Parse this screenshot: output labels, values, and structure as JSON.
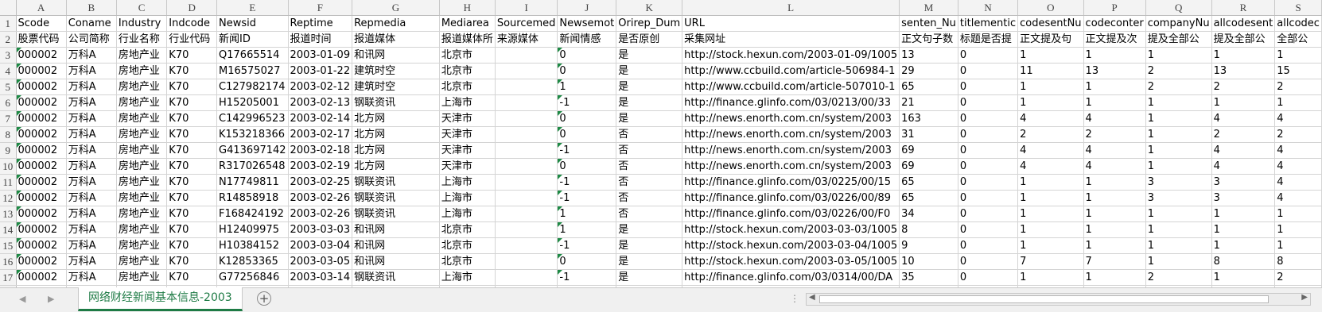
{
  "columns": [
    "A",
    "B",
    "C",
    "D",
    "E",
    "F",
    "G",
    "H",
    "I",
    "J",
    "K",
    "L",
    "M",
    "N",
    "O",
    "P",
    "Q",
    "R",
    "S"
  ],
  "rows": [
    {
      "n": "1",
      "cells": [
        "Scode",
        "Coname",
        "Industry",
        "Indcode",
        "Newsid",
        "Reptime",
        "Repmedia",
        "Mediarea",
        "Sourcemed",
        "Newsemot",
        "Orirep_Dum",
        "URL",
        "senten_Nu",
        "titlementic",
        "codesentNu",
        "codeconter",
        "companyNu",
        "allcodesent",
        "allcodec"
      ]
    },
    {
      "n": "2",
      "cells": [
        "股票代码",
        "公司简称",
        "行业名称",
        "行业代码",
        "新闻ID",
        "报道时间",
        "报道媒体",
        "报道媒体所",
        "来源媒体",
        "新闻情感",
        "是否原创",
        "采集网址",
        "正文句子数",
        "标题是否提",
        "正文提及句",
        "正文提及次",
        "提及全部公",
        "提及全部公",
        "全部公"
      ]
    },
    {
      "n": "3",
      "cells": [
        "000002",
        "万科A",
        "房地产业",
        "K70",
        "Q17665514",
        "2003-01-09",
        "和讯网",
        "北京市",
        "",
        "0",
        "是",
        "http://stock.hexun.com/2003-01-09/1005",
        "13",
        "0",
        "1",
        "1",
        "1",
        "1",
        "1"
      ]
    },
    {
      "n": "4",
      "cells": [
        "000002",
        "万科A",
        "房地产业",
        "K70",
        "M16575027",
        "2003-01-22",
        "建筑时空",
        "北京市",
        "",
        "0",
        "是",
        "http://www.ccbuild.com/article-506984-1",
        "29",
        "0",
        "11",
        "13",
        "2",
        "13",
        "15"
      ]
    },
    {
      "n": "5",
      "cells": [
        "000002",
        "万科A",
        "房地产业",
        "K70",
        "C127982174",
        "2003-02-12",
        "建筑时空",
        "北京市",
        "",
        "1",
        "是",
        "http://www.ccbuild.com/article-507010-1",
        "65",
        "0",
        "1",
        "1",
        "2",
        "2",
        "2"
      ]
    },
    {
      "n": "6",
      "cells": [
        "000002",
        "万科A",
        "房地产业",
        "K70",
        "H15205001",
        "2003-02-13",
        "钢联资讯",
        "上海市",
        "",
        "-1",
        "是",
        "http://finance.glinfo.com/03/0213/00/33",
        "21",
        "0",
        "1",
        "1",
        "1",
        "1",
        "1"
      ]
    },
    {
      "n": "7",
      "cells": [
        "000002",
        "万科A",
        "房地产业",
        "K70",
        "C142996523",
        "2003-02-14",
        "北方网",
        "天津市",
        "",
        "0",
        "是",
        "http://news.enorth.com.cn/system/2003",
        "163",
        "0",
        "4",
        "4",
        "1",
        "4",
        "4"
      ]
    },
    {
      "n": "8",
      "cells": [
        "000002",
        "万科A",
        "房地产业",
        "K70",
        "K153218366",
        "2003-02-17",
        "北方网",
        "天津市",
        "",
        "0",
        "否",
        "http://news.enorth.com.cn/system/2003",
        "31",
        "0",
        "2",
        "2",
        "1",
        "2",
        "2"
      ]
    },
    {
      "n": "9",
      "cells": [
        "000002",
        "万科A",
        "房地产业",
        "K70",
        "G413697142",
        "2003-02-18",
        "北方网",
        "天津市",
        "",
        "-1",
        "否",
        "http://news.enorth.com.cn/system/2003",
        "69",
        "0",
        "4",
        "4",
        "1",
        "4",
        "4"
      ]
    },
    {
      "n": "10",
      "cells": [
        "000002",
        "万科A",
        "房地产业",
        "K70",
        "R317026548",
        "2003-02-19",
        "北方网",
        "天津市",
        "",
        "0",
        "否",
        "http://news.enorth.com.cn/system/2003",
        "69",
        "0",
        "4",
        "4",
        "1",
        "4",
        "4"
      ]
    },
    {
      "n": "11",
      "cells": [
        "000002",
        "万科A",
        "房地产业",
        "K70",
        "N17749811",
        "2003-02-25",
        "钢联资讯",
        "上海市",
        "",
        "-1",
        "否",
        "http://finance.glinfo.com/03/0225/00/15",
        "65",
        "0",
        "1",
        "1",
        "3",
        "3",
        "4"
      ]
    },
    {
      "n": "12",
      "cells": [
        "000002",
        "万科A",
        "房地产业",
        "K70",
        "R14858918",
        "2003-02-26",
        "钢联资讯",
        "上海市",
        "",
        "-1",
        "否",
        "http://finance.glinfo.com/03/0226/00/89",
        "65",
        "0",
        "1",
        "1",
        "3",
        "3",
        "4"
      ]
    },
    {
      "n": "13",
      "cells": [
        "000002",
        "万科A",
        "房地产业",
        "K70",
        "F168424192",
        "2003-02-26",
        "钢联资讯",
        "上海市",
        "",
        "1",
        "否",
        "http://finance.glinfo.com/03/0226/00/F0",
        "34",
        "0",
        "1",
        "1",
        "1",
        "1",
        "1"
      ]
    },
    {
      "n": "14",
      "cells": [
        "000002",
        "万科A",
        "房地产业",
        "K70",
        "H12409975",
        "2003-03-03",
        "和讯网",
        "北京市",
        "",
        "1",
        "是",
        "http://stock.hexun.com/2003-03-03/1005",
        "8",
        "0",
        "1",
        "1",
        "1",
        "1",
        "1"
      ]
    },
    {
      "n": "15",
      "cells": [
        "000002",
        "万科A",
        "房地产业",
        "K70",
        "H10384152",
        "2003-03-04",
        "和讯网",
        "北京市",
        "",
        "-1",
        "是",
        "http://stock.hexun.com/2003-03-04/1005",
        "9",
        "0",
        "1",
        "1",
        "1",
        "1",
        "1"
      ]
    },
    {
      "n": "16",
      "cells": [
        "000002",
        "万科A",
        "房地产业",
        "K70",
        "K12853365",
        "2003-03-05",
        "和讯网",
        "北京市",
        "",
        "0",
        "是",
        "http://stock.hexun.com/2003-03-05/1005",
        "10",
        "0",
        "7",
        "7",
        "1",
        "8",
        "8"
      ]
    },
    {
      "n": "17",
      "cells": [
        "000002",
        "万科A",
        "房地产业",
        "K70",
        "G77256846",
        "2003-03-14",
        "钢联资讯",
        "上海市",
        "",
        "-1",
        "是",
        "http://finance.glinfo.com/03/0314/00/DA",
        "35",
        "0",
        "1",
        "1",
        "2",
        "1",
        "2"
      ]
    }
  ],
  "sheet_tab": "网络财经新闻基本信息-2003",
  "icons": {
    "prev_sheet": "triangle-left-icon",
    "next_sheet": "triangle-right-icon",
    "add_sheet": "plus-circle-icon",
    "split": "ellipsis-icon",
    "scroll_left": "scroll-left-icon",
    "scroll_right": "scroll-right-icon"
  },
  "accent_color": "#1e7b45"
}
